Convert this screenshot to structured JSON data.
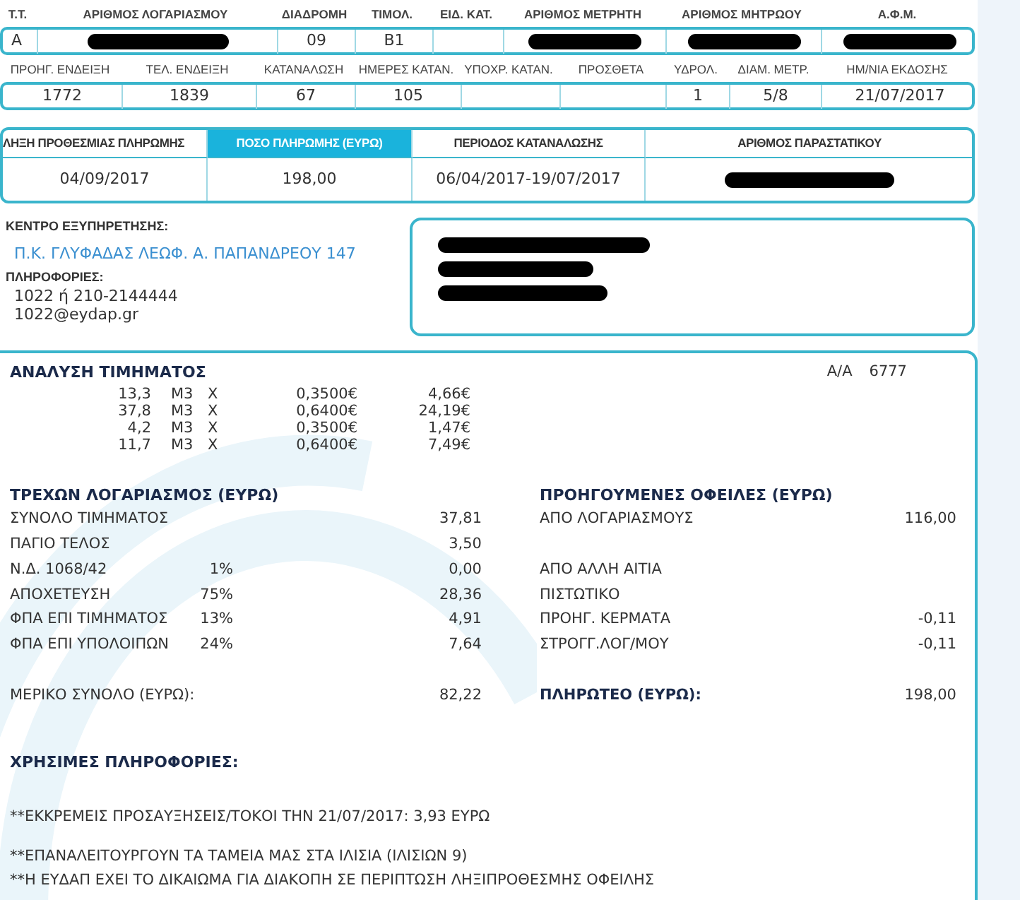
{
  "account_header": [
    {
      "label": "Τ.Τ.",
      "value": "A",
      "redacted": false
    },
    {
      "label": "ΑΡΙΘΜΟΣ ΛΟΓΑΡΙΑΣΜΟΥ",
      "redacted": true
    },
    {
      "label": "ΔΙΑΔΡΟΜΗ",
      "value": "09",
      "redacted": false
    },
    {
      "label": "ΤΙΜΟΛ.",
      "value": "B1",
      "redacted": false
    },
    {
      "label": "ΕΙΔ. ΚΑΤ.",
      "redacted": false
    },
    {
      "label": "ΑΡΙΘΜΟΣ ΜΕΤΡΗΤΗ",
      "redacted": true
    },
    {
      "label": "ΑΡΙΘΜΟΣ ΜΗΤΡΩΟΥ",
      "redacted": true
    },
    {
      "label": "Α.Φ.Μ.",
      "redacted": true
    }
  ],
  "meter_readings": [
    {
      "label": "ΠΡΟΗΓ. ΕΝΔΕΙΞΗ",
      "value": "1772"
    },
    {
      "label": "ΤΕΛ. ΕΝΔΕΙΞΗ",
      "value": "1839"
    },
    {
      "label": "ΚΑΤΑΝΑΛΩΣΗ",
      "value": "67"
    },
    {
      "label": "ΗΜΕΡΕΣ ΚΑΤΑΝ.",
      "value": "105"
    },
    {
      "label": "ΥΠΟΧΡ. ΚΑΤΑΝ."
    },
    {
      "label": "ΠΡΟΣΘΕΤΑ"
    },
    {
      "label": "ΥΔΡΟΛ.",
      "value": "1"
    },
    {
      "label": "ΔΙΑΜ. ΜΕΤΡ.",
      "value": "5/8"
    },
    {
      "label": "ΗΜ/ΝΙΑ ΕΚΔΟΣΗΣ",
      "value": "21/07/2017"
    }
  ],
  "payment": [
    {
      "label": "ΛΗΞΗ ΠΡΟΘΕΣΜΙΑΣ ΠΛΗΡΩΜΗΣ",
      "value": "04/09/2017",
      "highlighted": false,
      "redacted": false
    },
    {
      "label": "ΠΟΣΟ ΠΛΗΡΩΜΗΣ (ΕΥΡΩ)",
      "value": "198,00",
      "highlighted": true,
      "redacted": false
    },
    {
      "label": "ΠΕΡΙΟΔΟΣ ΚΑΤΑΝΑΛΩΣΗΣ",
      "value": "06/04/2017-19/07/2017",
      "highlighted": false,
      "redacted": false
    },
    {
      "label": "ΑΡΙΘΜΟΣ ΠΑΡΑΣΤΑΤΙΚΟΥ",
      "highlighted": false,
      "redacted": true
    }
  ],
  "service_center": {
    "title": "ΚΕΝΤΡΟ ΕΞΥΠΗΡΕΤΗΣΗΣ:",
    "address": "Π.Κ. ΓΛΥΦΑΔΑΣ ΛΕΩΦ. Α. ΠΑΠΑΝΔΡΕΟΥ 147",
    "info_title": "ΠΛΗΡΟΦΟΡΙΕΣ:",
    "phone": "1022 ή 210-2144444",
    "email": "1022@eydap.gr"
  },
  "recipient_address": {
    "lines": [
      {
        "redacted": true
      },
      {
        "redacted": true
      },
      {
        "redacted": true
      }
    ]
  },
  "charge_analysis": {
    "title": "ΑΝΑΛΥΣΗ ΤΙΜΗΜΑΤΟΣ",
    "serial_label": "Α/Α",
    "serial": "6777",
    "rows": [
      {
        "quantity": "13,3",
        "unit": "M3",
        "times": "X",
        "price": "0,3500€",
        "amount": "4,66€"
      },
      {
        "quantity": "37,8",
        "unit": "M3",
        "times": "X",
        "price": "0,6400€",
        "amount": "24,19€"
      },
      {
        "quantity": "4,2",
        "unit": "M3",
        "times": "X",
        "price": "0,3500€",
        "amount": "1,47€"
      },
      {
        "quantity": "11,7",
        "unit": "M3",
        "times": "X",
        "price": "0,6400€",
        "amount": "7,49€"
      }
    ]
  },
  "current_account": {
    "title": "ΤΡΕΧΩΝ ΛΟΓΑΡΙΑΣΜΟΣ (ΕΥΡΩ)",
    "items": [
      {
        "label": "ΣΥΝΟΛΟ ΤΙΜΗΜΑΤΟΣ",
        "value": "37,81"
      },
      {
        "label": "ΠΑΓΙΟ ΤΕΛΟΣ",
        "value": "3,50"
      },
      {
        "label": "Ν.Δ. 1068/42",
        "percent": "1%",
        "value": "0,00"
      },
      {
        "label": "ΑΠΟΧΕΤΕΥΣΗ",
        "percent": "75%",
        "value": "28,36"
      },
      {
        "label": "ΦΠΑ ΕΠΙ ΤΙΜΗΜΑΤΟΣ",
        "percent": "13%",
        "value": "4,91"
      },
      {
        "label": "ΦΠΑ ΕΠΙ ΥΠΟΛΟΙΠΩΝ",
        "percent": "24%",
        "value": "7,64"
      }
    ],
    "total_label": "ΜΕΡΙΚΟ ΣΥΝΟΛΟ (ΕΥΡΩ):",
    "total": "82,22"
  },
  "previous_debts": {
    "title": "ΠΡΟΗΓΟΥΜΕΝΕΣ ΟΦΕΙΛΕΣ (ΕΥΡΩ)",
    "items": [
      {
        "label": "ΑΠΟ ΛΟΓΑΡΙΑΣΜΟΥΣ",
        "value": "116,00",
        "spaced_before": false
      },
      {
        "label": "ΑΠΟ ΑΛΛΗ ΑΙΤΙΑ",
        "spaced_before": true
      },
      {
        "label": "ΠΙΣΤΩΤΙΚΟ",
        "spaced_before": false
      },
      {
        "label": "ΠΡΟΗΓ. ΚΕΡΜΑΤΑ",
        "value": "-0,11",
        "spaced_before": false
      },
      {
        "label": "ΣΤΡΟΓΓ.ΛΟΓ/ΜΟΥ",
        "value": "-0,11",
        "spaced_before": false
      }
    ],
    "total_label": "ΠΛΗΡΩΤΕΟ (ΕΥΡΩ):",
    "total": "198,00"
  },
  "useful_info": {
    "title": "ΧΡΗΣΙΜΕΣ ΠΛΗΡΟΦΟΡΙΕΣ:",
    "notes": [
      {
        "text": "**ΕΚΚΡΕΜΕΙΣ ΠΡΟΣΑΥΞΗΣΕΙΣ/ΤΟΚΟΙ ΤΗΝ 21/07/2017: 3,93 ΕΥΡΩ",
        "spaced_before": false
      },
      {
        "text": "**ΕΠΑΝΑΛΕΙΤΟΥΡΓΟΥΝ ΤΑ ΤΑΜΕΙΑ ΜΑΣ ΣΤΑ ΙΛΙΣΙΑ (ΙΛΙΣΙΩΝ 9)",
        "spaced_before": true
      },
      {
        "text": "**Η ΕΥΔΑΠ ΕΧΕΙ ΤΟ ΔΙΚΑΙΩΜΑ ΓΙΑ ΔΙΑΚΟΠΗ ΣΕ ΠΕΡΙΠΤΩΣΗ ΛΗΞΙΠΡΟΘΕΣΜΗΣ ΟΦΕΙΛΗΣ",
        "spaced_before": false
      }
    ]
  }
}
